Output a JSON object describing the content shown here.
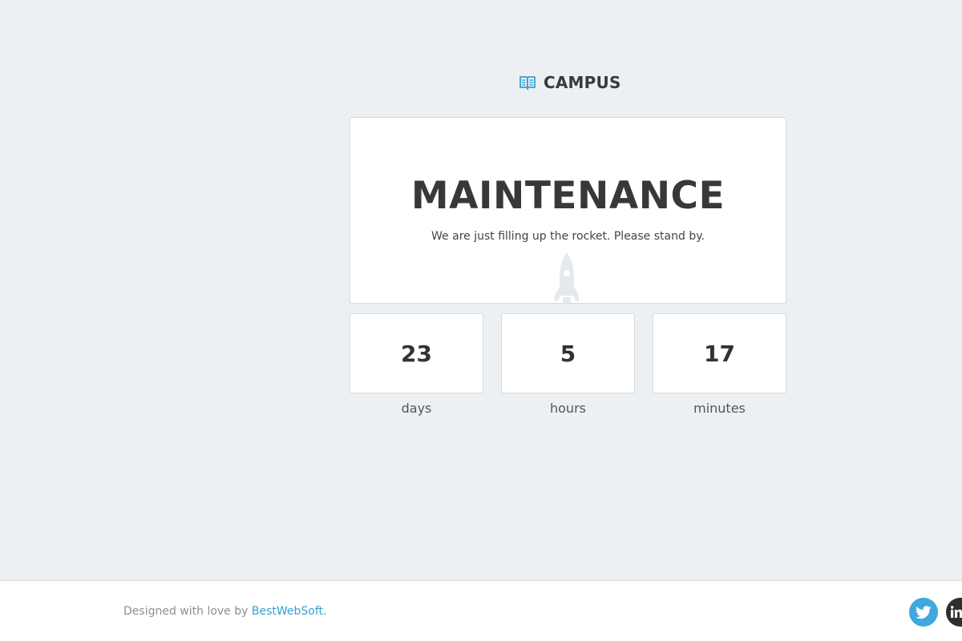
{
  "brand": {
    "name": "CAMPUS",
    "icon": "book-icon",
    "accent_color": "#3aa0cf"
  },
  "main": {
    "title": "MAINTENANCE",
    "subtitle": "We are just filling up the rocket. Please stand by.",
    "decoration_icon": "rocket-icon"
  },
  "countdown": [
    {
      "value": "23",
      "label": "days"
    },
    {
      "value": "5",
      "label": "hours"
    },
    {
      "value": "17",
      "label": "minutes"
    }
  ],
  "footer": {
    "credit_prefix": "Designed with love by ",
    "credit_link": "BestWebSoft",
    "credit_suffix": ".",
    "link_color": "#2fa3d1",
    "social": [
      {
        "name": "twitter",
        "icon": "twitter-icon",
        "color": "#3fa9dd"
      },
      {
        "name": "linkedin",
        "icon": "linkedin-icon",
        "color": "#2e2e2e"
      }
    ]
  }
}
